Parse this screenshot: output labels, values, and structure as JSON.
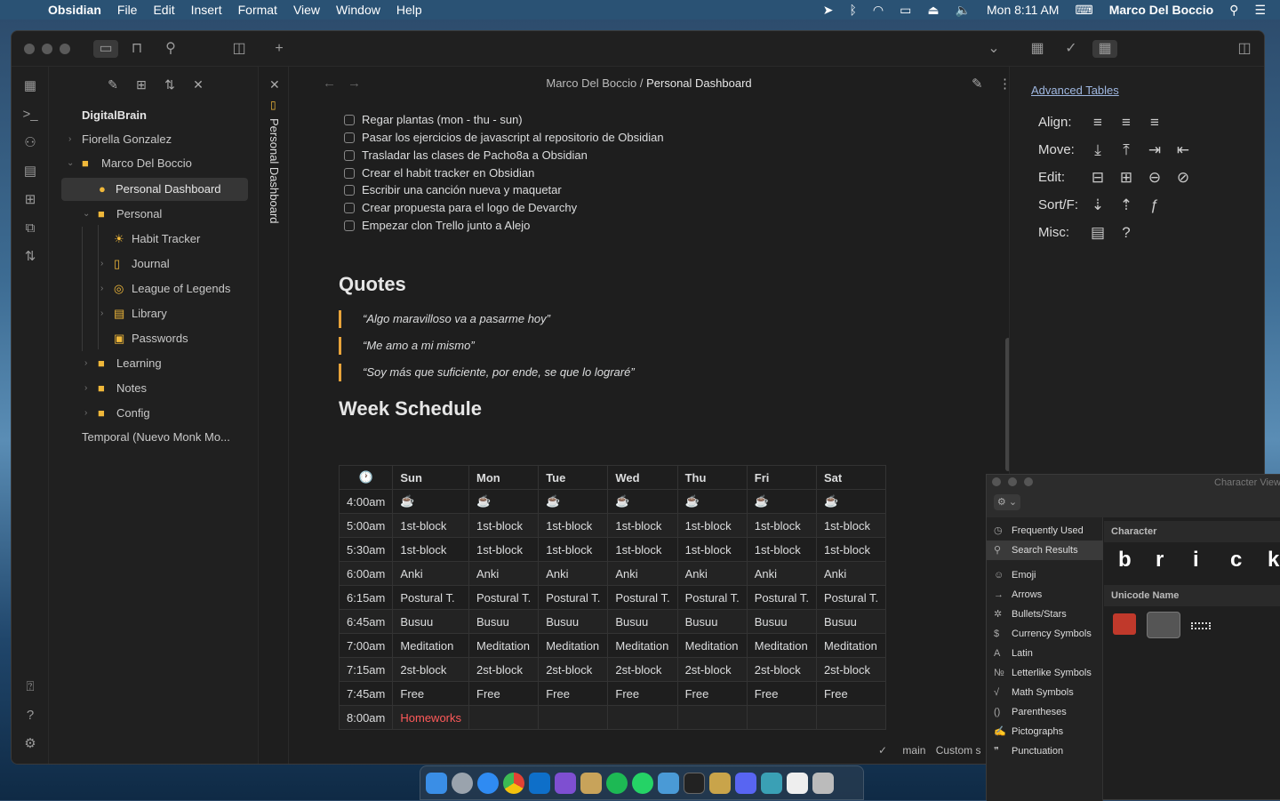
{
  "menubar": {
    "app": "Obsidian",
    "items": [
      "File",
      "Edit",
      "Insert",
      "Format",
      "View",
      "Window",
      "Help"
    ],
    "clock": "Mon 8:11 AM",
    "user": "Marco Del Boccio"
  },
  "breadcrumb": {
    "folder": "Marco Del Boccio",
    "separator": "/",
    "note": "Personal Dashboard"
  },
  "sidetab": {
    "label": "Personal Dashboard"
  },
  "tree": {
    "vault": "DigitalBrain",
    "items": [
      {
        "label": "Fiorella Gonzalez"
      },
      {
        "label": "Marco Del Boccio"
      },
      {
        "label": "Personal Dashboard"
      },
      {
        "label": "Personal"
      },
      {
        "label": "Habit Tracker"
      },
      {
        "label": "Journal"
      },
      {
        "label": "League of Legends"
      },
      {
        "label": "Library"
      },
      {
        "label": "Passwords"
      },
      {
        "label": "Learning"
      },
      {
        "label": "Notes"
      },
      {
        "label": "Config"
      },
      {
        "label": "Temporal (Nuevo Monk Mo..."
      }
    ]
  },
  "tasks": [
    "Regar plantas (mon - thu - sun)",
    "Pasar los ejercicios de javascript al repositorio de Obsidian",
    "Trasladar las clases de Pacho8a a Obsidian",
    "Crear el habit tracker en Obsidian",
    "Escribir una canción nueva y maquetar",
    "Crear propuesta para el logo de Devarchy",
    "Empezar clon Trello junto a Alejo"
  ],
  "quotes": {
    "heading": "Quotes",
    "items": [
      "“Algo maravilloso va a pasarme hoy”",
      "“Me amo a mi mismo”",
      "“Soy más que suficiente, por ende, se que lo lograré”"
    ]
  },
  "schedule": {
    "heading": "Week Schedule",
    "headers": [
      "🕐",
      "Sun",
      "Mon",
      "Tue",
      "Wed",
      "Thu",
      "Fri",
      "Sat"
    ],
    "rows": [
      [
        "4:00am",
        "☕",
        "☕",
        "☕",
        "☕",
        "☕",
        "☕",
        "☕"
      ],
      [
        "5:00am",
        "1st-block",
        "1st-block",
        "1st-block",
        "1st-block",
        "1st-block",
        "1st-block",
        "1st-block"
      ],
      [
        "5:30am",
        "1st-block",
        "1st-block",
        "1st-block",
        "1st-block",
        "1st-block",
        "1st-block",
        "1st-block"
      ],
      [
        "6:00am",
        "Anki",
        "Anki",
        "Anki",
        "Anki",
        "Anki",
        "Anki",
        "Anki"
      ],
      [
        "6:15am",
        "Postural T.",
        "Postural T.",
        "Postural T.",
        "Postural T.",
        "Postural T.",
        "Postural T.",
        "Postural T."
      ],
      [
        "6:45am",
        "Busuu",
        "Busuu",
        "Busuu",
        "Busuu",
        "Busuu",
        "Busuu",
        "Busuu"
      ],
      [
        "7:00am",
        "Meditation",
        "Meditation",
        "Meditation",
        "Meditation",
        "Meditation",
        "Meditation",
        "Meditation"
      ],
      [
        "7:15am",
        "2st-block",
        "2st-block",
        "2st-block",
        "2st-block",
        "2st-block",
        "2st-block",
        "2st-block"
      ],
      [
        "7:45am",
        "Free",
        "Free",
        "Free",
        "Free",
        "Free",
        "Free",
        "Free"
      ],
      [
        "8:00am",
        "Homeworks",
        "",
        "",
        "",
        "",
        "",
        ""
      ]
    ],
    "highlight_color": "#ff5a5a"
  },
  "advanced_tables": {
    "title": "Advanced Tables",
    "rows": [
      {
        "label": "Align:",
        "icons": [
          "align-left-icon",
          "align-center-icon",
          "align-right-icon"
        ]
      },
      {
        "label": "Move:",
        "icons": [
          "move-row-down-icon",
          "move-row-up-icon",
          "move-col-right-icon",
          "move-col-left-icon"
        ]
      },
      {
        "label": "Edit:",
        "icons": [
          "insert-row-icon",
          "insert-col-icon",
          "delete-row-icon",
          "delete-col-icon"
        ]
      },
      {
        "label": "Sort/F:",
        "icons": [
          "sort-asc-icon",
          "sort-desc-icon",
          "formula-icon"
        ]
      },
      {
        "label": "Misc:",
        "icons": [
          "csv-icon",
          "help-icon"
        ]
      }
    ]
  },
  "statusbar": {
    "branch": "main",
    "mode": "Custom s"
  },
  "character_viewer": {
    "title": "Character View",
    "categories": [
      "Frequently Used",
      "Search Results",
      "Emoji",
      "Arrows",
      "Bullets/Stars",
      "Currency Symbols",
      "Latin",
      "Letterlike Symbols",
      "Math Symbols",
      "Parentheses",
      "Pictographs",
      "Punctuation"
    ],
    "character_header": "Character",
    "unicode_header": "Unicode Name",
    "glyphs": [
      "b",
      "r",
      "i",
      "c",
      "k"
    ]
  }
}
